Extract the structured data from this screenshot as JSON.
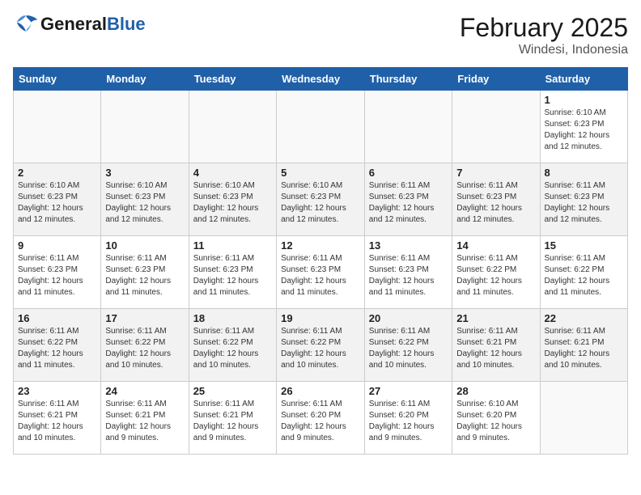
{
  "header": {
    "logo_general": "General",
    "logo_blue": "Blue",
    "month": "February 2025",
    "location": "Windesi, Indonesia"
  },
  "weekdays": [
    "Sunday",
    "Monday",
    "Tuesday",
    "Wednesday",
    "Thursday",
    "Friday",
    "Saturday"
  ],
  "weeks": [
    [
      {
        "day": "",
        "info": ""
      },
      {
        "day": "",
        "info": ""
      },
      {
        "day": "",
        "info": ""
      },
      {
        "day": "",
        "info": ""
      },
      {
        "day": "",
        "info": ""
      },
      {
        "day": "",
        "info": ""
      },
      {
        "day": "1",
        "info": "Sunrise: 6:10 AM\nSunset: 6:23 PM\nDaylight: 12 hours\nand 12 minutes."
      }
    ],
    [
      {
        "day": "2",
        "info": "Sunrise: 6:10 AM\nSunset: 6:23 PM\nDaylight: 12 hours\nand 12 minutes."
      },
      {
        "day": "3",
        "info": "Sunrise: 6:10 AM\nSunset: 6:23 PM\nDaylight: 12 hours\nand 12 minutes."
      },
      {
        "day": "4",
        "info": "Sunrise: 6:10 AM\nSunset: 6:23 PM\nDaylight: 12 hours\nand 12 minutes."
      },
      {
        "day": "5",
        "info": "Sunrise: 6:10 AM\nSunset: 6:23 PM\nDaylight: 12 hours\nand 12 minutes."
      },
      {
        "day": "6",
        "info": "Sunrise: 6:11 AM\nSunset: 6:23 PM\nDaylight: 12 hours\nand 12 minutes."
      },
      {
        "day": "7",
        "info": "Sunrise: 6:11 AM\nSunset: 6:23 PM\nDaylight: 12 hours\nand 12 minutes."
      },
      {
        "day": "8",
        "info": "Sunrise: 6:11 AM\nSunset: 6:23 PM\nDaylight: 12 hours\nand 12 minutes."
      }
    ],
    [
      {
        "day": "9",
        "info": "Sunrise: 6:11 AM\nSunset: 6:23 PM\nDaylight: 12 hours\nand 11 minutes."
      },
      {
        "day": "10",
        "info": "Sunrise: 6:11 AM\nSunset: 6:23 PM\nDaylight: 12 hours\nand 11 minutes."
      },
      {
        "day": "11",
        "info": "Sunrise: 6:11 AM\nSunset: 6:23 PM\nDaylight: 12 hours\nand 11 minutes."
      },
      {
        "day": "12",
        "info": "Sunrise: 6:11 AM\nSunset: 6:23 PM\nDaylight: 12 hours\nand 11 minutes."
      },
      {
        "day": "13",
        "info": "Sunrise: 6:11 AM\nSunset: 6:23 PM\nDaylight: 12 hours\nand 11 minutes."
      },
      {
        "day": "14",
        "info": "Sunrise: 6:11 AM\nSunset: 6:22 PM\nDaylight: 12 hours\nand 11 minutes."
      },
      {
        "day": "15",
        "info": "Sunrise: 6:11 AM\nSunset: 6:22 PM\nDaylight: 12 hours\nand 11 minutes."
      }
    ],
    [
      {
        "day": "16",
        "info": "Sunrise: 6:11 AM\nSunset: 6:22 PM\nDaylight: 12 hours\nand 11 minutes."
      },
      {
        "day": "17",
        "info": "Sunrise: 6:11 AM\nSunset: 6:22 PM\nDaylight: 12 hours\nand 10 minutes."
      },
      {
        "day": "18",
        "info": "Sunrise: 6:11 AM\nSunset: 6:22 PM\nDaylight: 12 hours\nand 10 minutes."
      },
      {
        "day": "19",
        "info": "Sunrise: 6:11 AM\nSunset: 6:22 PM\nDaylight: 12 hours\nand 10 minutes."
      },
      {
        "day": "20",
        "info": "Sunrise: 6:11 AM\nSunset: 6:22 PM\nDaylight: 12 hours\nand 10 minutes."
      },
      {
        "day": "21",
        "info": "Sunrise: 6:11 AM\nSunset: 6:21 PM\nDaylight: 12 hours\nand 10 minutes."
      },
      {
        "day": "22",
        "info": "Sunrise: 6:11 AM\nSunset: 6:21 PM\nDaylight: 12 hours\nand 10 minutes."
      }
    ],
    [
      {
        "day": "23",
        "info": "Sunrise: 6:11 AM\nSunset: 6:21 PM\nDaylight: 12 hours\nand 10 minutes."
      },
      {
        "day": "24",
        "info": "Sunrise: 6:11 AM\nSunset: 6:21 PM\nDaylight: 12 hours\nand 9 minutes."
      },
      {
        "day": "25",
        "info": "Sunrise: 6:11 AM\nSunset: 6:21 PM\nDaylight: 12 hours\nand 9 minutes."
      },
      {
        "day": "26",
        "info": "Sunrise: 6:11 AM\nSunset: 6:20 PM\nDaylight: 12 hours\nand 9 minutes."
      },
      {
        "day": "27",
        "info": "Sunrise: 6:11 AM\nSunset: 6:20 PM\nDaylight: 12 hours\nand 9 minutes."
      },
      {
        "day": "28",
        "info": "Sunrise: 6:10 AM\nSunset: 6:20 PM\nDaylight: 12 hours\nand 9 minutes."
      },
      {
        "day": "",
        "info": ""
      }
    ]
  ]
}
